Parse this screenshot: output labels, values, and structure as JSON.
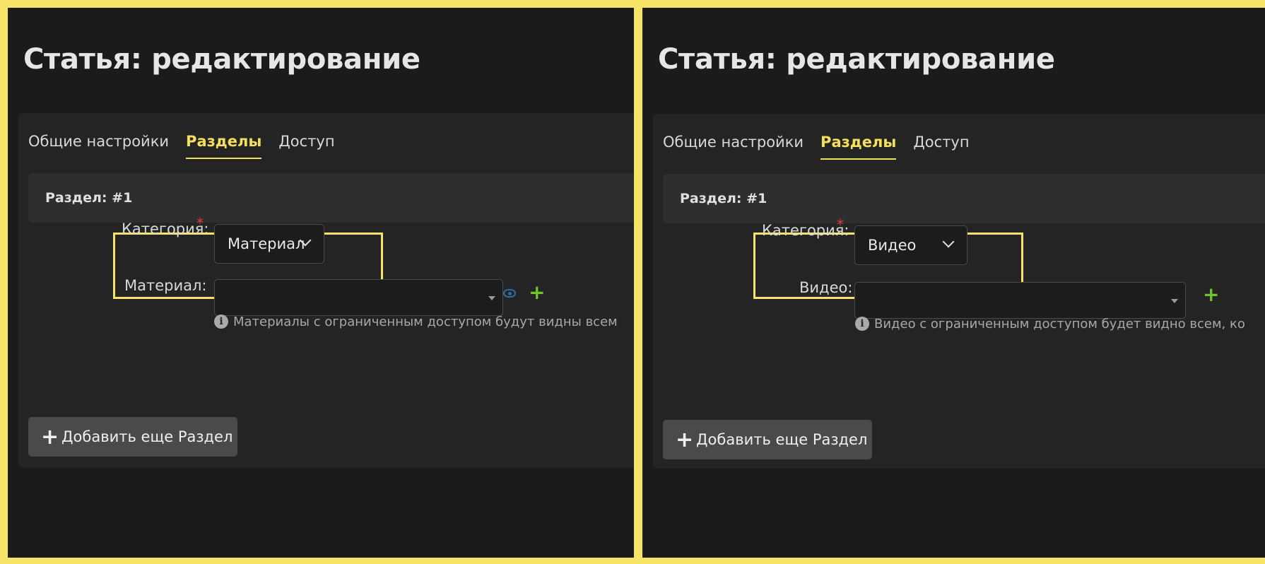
{
  "panels": [
    {
      "page_title": "Статья: редактирование",
      "tabs": [
        {
          "label": "Общие настройки",
          "active": false
        },
        {
          "label": "Разделы",
          "active": true
        },
        {
          "label": "Доступ",
          "active": false
        }
      ],
      "section_label": "Раздел:  #1",
      "category_label": "Категория:",
      "required_mark": "*",
      "category_value": "Материал",
      "item_label": "Материал:",
      "item_value": "",
      "add_icon": "+",
      "hint_text": "Материалы с ограниченным доступом будут видны всем",
      "info_icon": "i",
      "add_section_icon": "+",
      "add_section_label": "Добавить еще Раздел"
    },
    {
      "page_title": "Статья: редактирование",
      "tabs": [
        {
          "label": "Общие настройки",
          "active": false
        },
        {
          "label": "Разделы",
          "active": true
        },
        {
          "label": "Доступ",
          "active": false
        }
      ],
      "section_label": "Раздел:  #1",
      "category_label": "Категория:",
      "required_mark": "*",
      "category_value": "Видео",
      "item_label": "Видео:",
      "item_value": "",
      "add_icon": "+",
      "hint_text": "Видео с ограниченным доступом будет видно всем, ко",
      "info_icon": "i",
      "add_section_icon": "+",
      "add_section_label": "Добавить еще Раздел"
    }
  ],
  "colors": {
    "accent": "#f3df5e",
    "highlight": "#f6e466",
    "required": "#e23a3a",
    "add_green": "#6fc52d",
    "eye_blue": "#2d6ea8"
  },
  "icons": {
    "category_chevron": "chevron-down-icon",
    "combo_caret": "caret-down-icon",
    "add": "plus-icon",
    "view": "eye-icon",
    "info": "info-icon"
  }
}
